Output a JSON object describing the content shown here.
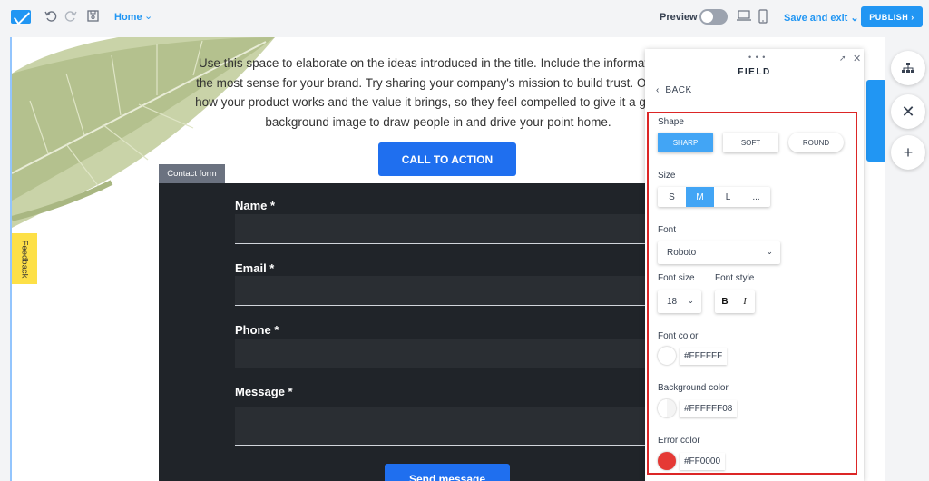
{
  "topbar": {
    "page_selector": "Home",
    "preview_label": "Preview",
    "save_exit_label": "Save and exit",
    "publish_label": "PUBLISH"
  },
  "canvas": {
    "intro_lines": [
      "Use this space to elaborate on the ideas introduced in the title. Include the information th",
      "the most sense for your brand. Try sharing your company's mission to build trust. Or, brief",
      "how your product works and the value it brings, so they feel compelled to give it a go. Cus",
      "background image to draw people in and drive your point home."
    ],
    "cta_label": "CALL TO ACTION",
    "contact_form_tag": "Contact form",
    "fields": [
      {
        "label": "Name *"
      },
      {
        "label": "Email *"
      },
      {
        "label": "Phone *"
      },
      {
        "label": "Message *"
      }
    ],
    "send_label": "Send message",
    "feedback_label": "Feedback"
  },
  "panel": {
    "title": "FIELD",
    "back_label": "BACK",
    "shape_label": "Shape",
    "shape_options": [
      "SHARP",
      "SOFT",
      "ROUND"
    ],
    "shape_selected": "SHARP",
    "size_label": "Size",
    "size_options": [
      "S",
      "M",
      "L",
      "..."
    ],
    "size_selected": "M",
    "font_label": "Font",
    "font_value": "Roboto",
    "font_size_label": "Font size",
    "font_size_value": "18",
    "font_style_label": "Font style",
    "bold_label": "B",
    "italic_label": "I",
    "font_color_label": "Font color",
    "font_color_value": "#FFFFFF",
    "bg_color_label": "Background color",
    "bg_color_value": "#FFFFFF08",
    "error_color_label": "Error color",
    "error_color_value": "#FF0000"
  },
  "colors": {
    "accent": "#2196f3",
    "highlight": "#dc2626",
    "form_bg": "#202429",
    "error_swatch": "#e53935"
  }
}
